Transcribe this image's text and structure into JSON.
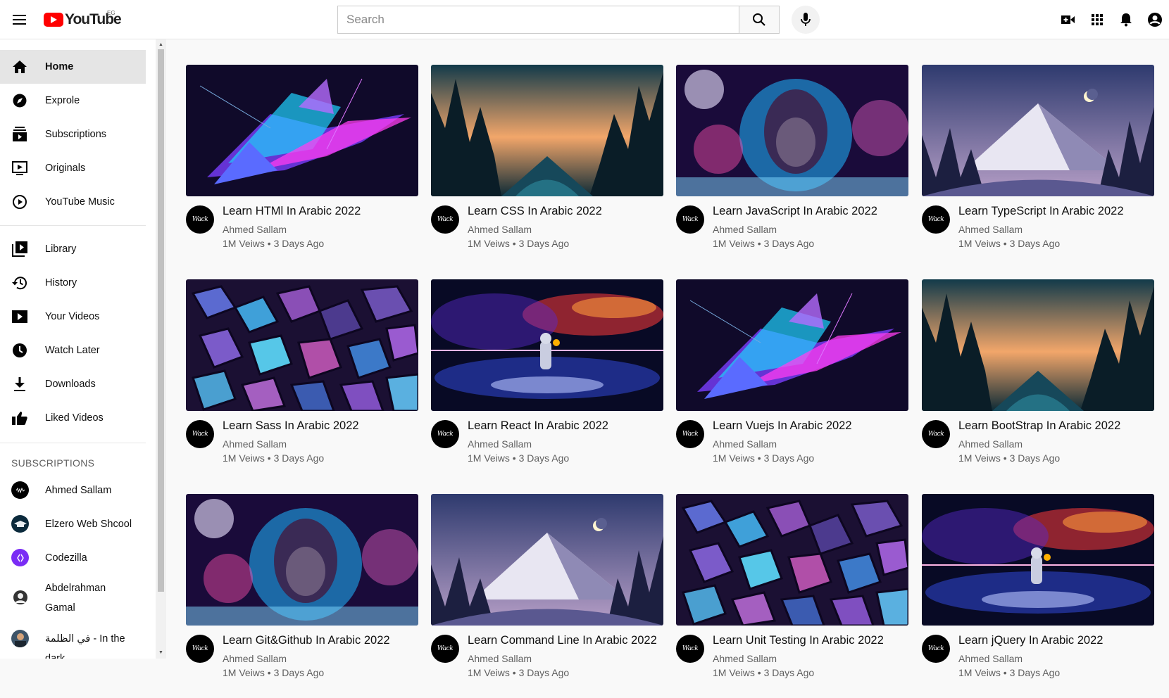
{
  "header": {
    "logo_text": "YouTube",
    "region": "EG",
    "search_placeholder": "Search",
    "icons": [
      "menu-icon",
      "search-icon",
      "mic-icon",
      "create-video-icon",
      "apps-grid-icon",
      "notifications-bell-icon",
      "account-icon"
    ]
  },
  "sidebar": {
    "main": [
      {
        "label": "Home",
        "icon": "home-icon"
      },
      {
        "label": "Exprole",
        "icon": "explore-icon"
      },
      {
        "label": "Subscriptions",
        "icon": "subscriptions-icon"
      },
      {
        "label": "Originals",
        "icon": "originals-icon"
      },
      {
        "label": "YouTube Music",
        "icon": "music-icon"
      }
    ],
    "library": [
      {
        "label": "Library",
        "icon": "library-icon"
      },
      {
        "label": "History",
        "icon": "history-icon"
      },
      {
        "label": "Your Videos",
        "icon": "your-videos-icon"
      },
      {
        "label": "Watch Later",
        "icon": "watch-later-icon"
      },
      {
        "label": "Downloads",
        "icon": "download-icon"
      },
      {
        "label": "Liked Videos",
        "icon": "like-icon"
      }
    ],
    "subscriptions_title": "SUBSCRIPTIONS",
    "subscriptions": [
      {
        "label": "Ahmed Sallam"
      },
      {
        "label": "Elzero Web Shcool"
      },
      {
        "label": "Codezilla"
      },
      {
        "label": "Abdelrahman Gamal"
      },
      {
        "label": "في الظلمة - In the dark"
      }
    ]
  },
  "videos": [
    {
      "title": "Learn HTMl In Arabic 2022",
      "channel": "Ahmed Sallam",
      "meta": "1M Veiws • 3 Days Ago",
      "thumb": "crystal"
    },
    {
      "title": "Learn CSS In Arabic 2022",
      "channel": "Ahmed Sallam",
      "meta": "1M Veiws • 3 Days Ago",
      "thumb": "forest"
    },
    {
      "title": "Learn JavaScript In Arabic 2022",
      "channel": "Ahmed Sallam",
      "meta": "1M Veiws • 3 Days Ago",
      "thumb": "lion"
    },
    {
      "title": "Learn TypeScript In Arabic 2022",
      "channel": "Ahmed Sallam",
      "meta": "1M Veiws • 3 Days Ago",
      "thumb": "mountain"
    },
    {
      "title": "Learn Sass In Arabic 2022",
      "channel": "Ahmed Sallam",
      "meta": "1M Veiws • 3 Days Ago",
      "thumb": "cubes"
    },
    {
      "title": "Learn React In Arabic 2022",
      "channel": "Ahmed Sallam",
      "meta": "1M Veiws • 3 Days Ago",
      "thumb": "astronaut"
    },
    {
      "title": "Learn Vuejs In Arabic 2022",
      "channel": "Ahmed Sallam",
      "meta": "1M Veiws • 3 Days Ago",
      "thumb": "crystal"
    },
    {
      "title": "Learn BootStrap In Arabic 2022",
      "channel": "Ahmed Sallam",
      "meta": "1M Veiws • 3 Days Ago",
      "thumb": "forest"
    },
    {
      "title": "Learn Git&Github In Arabic 2022",
      "channel": "Ahmed Sallam",
      "meta": "1M Veiws • 3 Days Ago",
      "thumb": "lion"
    },
    {
      "title": "Learn Command Line In Arabic 2022",
      "channel": "Ahmed Sallam",
      "meta": "1M Veiws • 3 Days Ago",
      "thumb": "mountain"
    },
    {
      "title": "Learn Unit Testing In Arabic 2022",
      "channel": "Ahmed Sallam",
      "meta": "1M Veiws • 3 Days Ago",
      "thumb": "cubes"
    },
    {
      "title": "Learn jQuery In Arabic 2022",
      "channel": "Ahmed Sallam",
      "meta": "1M Veiws • 3 Days Ago",
      "thumb": "astronaut"
    }
  ],
  "colors": {
    "brand_red": "#ff0000",
    "text_primary": "#0f0f0f",
    "text_secondary": "#606060"
  }
}
